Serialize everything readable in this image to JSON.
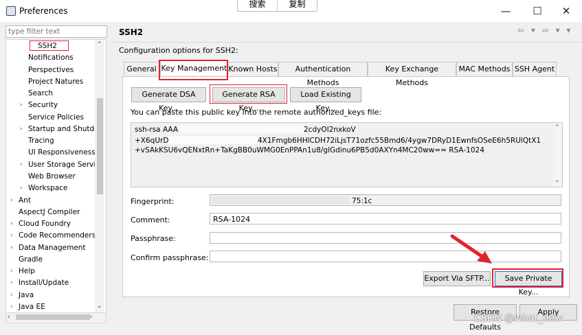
{
  "window": {
    "title": "Preferences",
    "minimize": "—",
    "maximize": "☐",
    "close": "✕",
    "float_toolbar": [
      "搜索",
      "复制"
    ]
  },
  "filter": {
    "placeholder": "type filter text"
  },
  "tree": {
    "items": [
      {
        "label": "SSH2",
        "selected": true
      },
      {
        "label": "Notifications"
      },
      {
        "label": "Perspectives"
      },
      {
        "label": "Project Natures"
      },
      {
        "label": "Search"
      },
      {
        "label": "Security",
        "expandable": true
      },
      {
        "label": "Service Policies"
      },
      {
        "label": "Startup and Shutdo",
        "expandable": true
      },
      {
        "label": "Tracing"
      },
      {
        "label": "UI Responsiveness"
      },
      {
        "label": "User Storage Servic",
        "expandable": true
      },
      {
        "label": "Web Browser"
      },
      {
        "label": "Workspace",
        "expandable": true
      },
      {
        "label": "Ant",
        "expandable": true
      },
      {
        "label": "AspectJ Compiler"
      },
      {
        "label": "Cloud Foundry",
        "expandable": true
      },
      {
        "label": "Code Recommenders",
        "expandable": true
      },
      {
        "label": "Data Management",
        "expandable": true
      },
      {
        "label": "Gradle"
      },
      {
        "label": "Help",
        "expandable": true
      },
      {
        "label": "Install/Update",
        "expandable": true
      },
      {
        "label": "Java",
        "expandable": true
      },
      {
        "label": "Java EE",
        "expandable": true
      }
    ]
  },
  "page": {
    "title": "SSH2",
    "nav": "⇦ ▾ ⇨ ▾ ▾",
    "description": "Configuration options for SSH2:"
  },
  "tabs": [
    "General",
    "Key Management",
    "Known Hosts",
    "Authentication Methods",
    "Key Exchange Methods",
    "MAC Methods",
    "SSH Agent"
  ],
  "key_management": {
    "gen_dsa": "Generate DSA Key...",
    "gen_rsa": "Generate RSA Key...",
    "load_key": "Load Existing Key...",
    "paste_info": "You can paste this public key into the remote authorized_keys file:",
    "key_lines": [
      "ssh-rsa AAA",
      "2cdyOI2nxkoV",
      "+X6qUrD",
      "4X1Fmgb6HHlCDH72iLjsT71ozfc55Bmd6/4ygw7DRyD1EwnfsOSeE6h5RUlQtX1",
      "+vSAkKSU6vQENxtRn+TaKgBB0uWMG0EnPPAn1u8/glGdinu6PB5d0AXYn4MC20ww== RSA-1024"
    ],
    "fingerprint_label": "Fingerprint:",
    "fingerprint_value": "75:1c",
    "comment_label": "Comment:",
    "comment_value": "RSA-1024",
    "passphrase_label": "Passphrase:",
    "confirm_label": "Confirm passphrase:",
    "export": "Export Via SFTP...",
    "save_private": "Save Private Key..."
  },
  "footer": {
    "restore": "Restore Defaults",
    "apply": "Apply",
    "watermark": "CSDN @what_new"
  },
  "colors": {
    "highlight": "#e0242b",
    "tab_active": "#ffffff"
  }
}
